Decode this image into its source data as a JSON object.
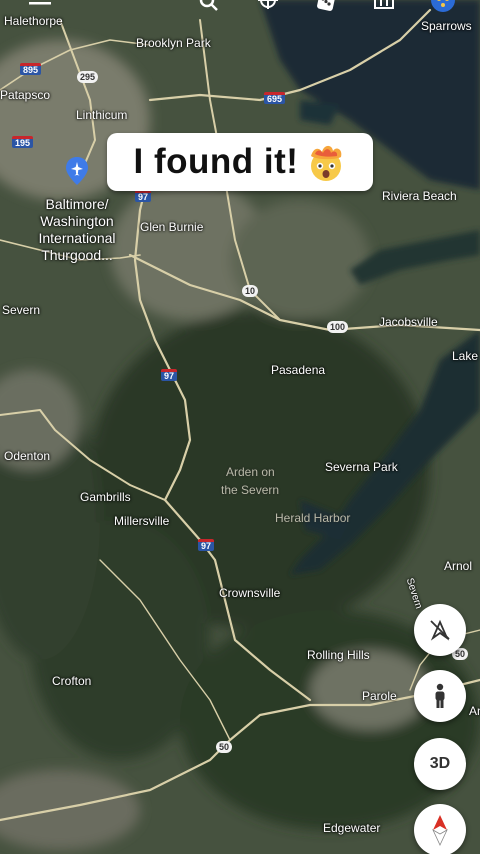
{
  "banner": {
    "text": "I found it!",
    "emoji": "exploding-head-emoji"
  },
  "toolbar": {
    "icons": [
      "menu-icon",
      "search-icon",
      "voyager-icon",
      "dice-icon",
      "projects-icon",
      "profile-icon"
    ]
  },
  "places": {
    "halethorpe": "Halethorpe",
    "brooklyn_park": "Brooklyn Park",
    "sparrows": "Sparrows",
    "patapsco": "Patapsco",
    "linthicum": "Linthicum",
    "bwi_line1": "Baltimore/",
    "bwi_line2": "Washington",
    "bwi_line3": "International",
    "bwi_line4": "Thurgood...",
    "glen_burnie": "Glen Burnie",
    "riviera_beach": "Riviera Beach",
    "severn": "Severn",
    "jacobsville": "Jacobsville",
    "pasadena": "Pasadena",
    "lake": "Lake",
    "odenton": "Odenton",
    "severna_park": "Severna Park",
    "arden_line1": "Arden on",
    "arden_line2": "the Severn",
    "herald_harbor": "Herald Harbor",
    "gambrills": "Gambrills",
    "millersville": "Millersville",
    "arnold": "Arnol",
    "severn_river": "Severn",
    "crownsville": "Crownsville",
    "rolling_hills": "Rolling Hills",
    "crofton": "Crofton",
    "parole": "Parole",
    "an": "An",
    "edgewater": "Edgewater"
  },
  "routes": {
    "i895": "895",
    "r295": "295",
    "i695": "695",
    "i195": "195",
    "r97a": "97",
    "r10": "10",
    "r100": "100",
    "r97b": "97",
    "r97c": "97",
    "r50": "50",
    "r50b": "50"
  },
  "controls": {
    "three_d_label": "3D",
    "icons": [
      "no-tilt-icon",
      "pegman-icon",
      "compass-icon"
    ]
  },
  "colors": {
    "water": "#1c2e38",
    "forest_dark": "#253322",
    "land": "#4a5744",
    "urban": "#7d8070",
    "road": "#d8cfa8",
    "interstate_blue": "#2b55a5",
    "compass_red": "#d93025"
  }
}
